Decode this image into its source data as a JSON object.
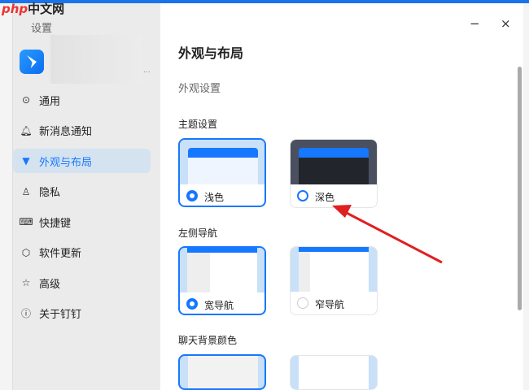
{
  "watermark": {
    "php": "php",
    "cn": "中文网"
  },
  "window": {
    "title": "设置",
    "minimize": "−",
    "close": "×",
    "ellipsis": "..."
  },
  "sidebar": {
    "items": [
      {
        "label": "通用",
        "icon": "gear-icon"
      },
      {
        "label": "新消息通知",
        "icon": "bell-icon"
      },
      {
        "label": "外观与布局",
        "icon": "shirt-icon",
        "active": true
      },
      {
        "label": "隐私",
        "icon": "user-icon"
      },
      {
        "label": "快捷键",
        "icon": "keyboard-icon"
      },
      {
        "label": "软件更新",
        "icon": "box-icon"
      },
      {
        "label": "高级",
        "icon": "star-icon"
      },
      {
        "label": "关于钉钉",
        "icon": "info-icon"
      }
    ]
  },
  "main": {
    "title": "外观与布局",
    "subtitle": "外观设置",
    "theme": {
      "label": "主题设置",
      "options": [
        {
          "label": "浅色",
          "selected": true
        },
        {
          "label": "深色",
          "selected": false
        }
      ]
    },
    "nav": {
      "label": "左侧导航",
      "options": [
        {
          "label": "宽导航",
          "selected": true
        },
        {
          "label": "窄导航",
          "selected": false
        }
      ]
    },
    "chatbg": {
      "label": "聊天背景颜色"
    }
  },
  "colors": {
    "accent": "#1677ff",
    "arrow": "#e02020"
  }
}
